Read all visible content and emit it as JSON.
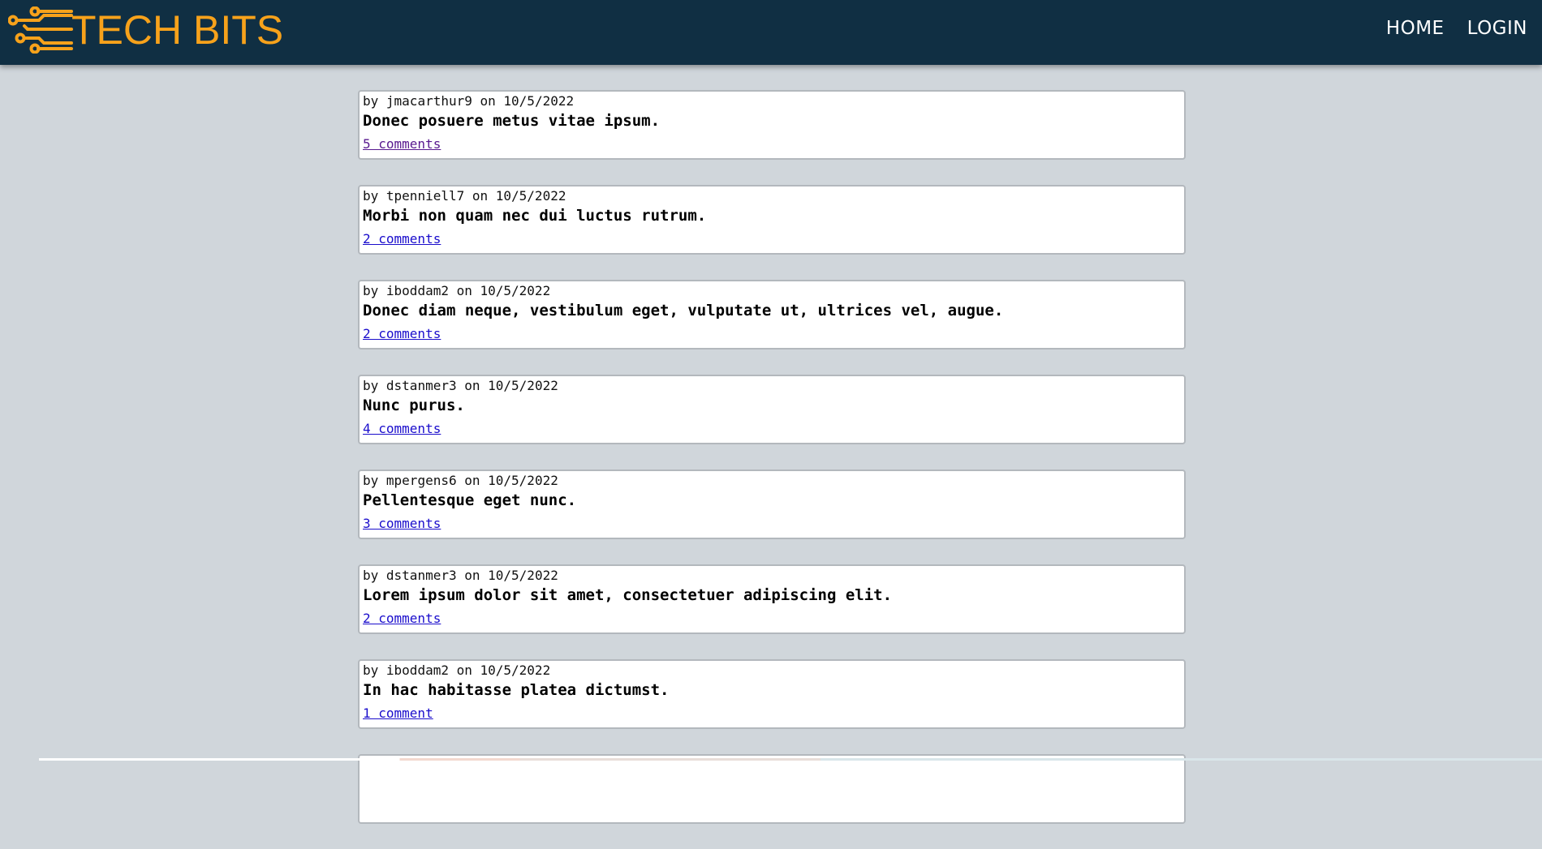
{
  "header": {
    "logo_text": "TECH BITS",
    "logo_icon": "circuit-icon",
    "nav": {
      "home": "HOME",
      "login": "LOGIN"
    },
    "colors": {
      "bar": "#102f43",
      "brand": "#f7a21b"
    }
  },
  "posts": [
    {
      "author": "jmacarthur9",
      "date": "10/5/2022",
      "title": "Donec posuere metus vitae ipsum.",
      "comments": "5 comments",
      "visited": true
    },
    {
      "author": "tpenniell7",
      "date": "10/5/2022",
      "title": "Morbi non quam nec dui luctus rutrum.",
      "comments": "2 comments",
      "visited": false
    },
    {
      "author": "iboddam2",
      "date": "10/5/2022",
      "title": "Donec diam neque, vestibulum eget, vulputate ut, ultrices vel, augue.",
      "comments": "2 comments",
      "visited": false
    },
    {
      "author": "dstanmer3",
      "date": "10/5/2022",
      "title": "Nunc purus.",
      "comments": "4 comments",
      "visited": false
    },
    {
      "author": "mpergens6",
      "date": "10/5/2022",
      "title": "Pellentesque eget nunc.",
      "comments": "3 comments",
      "visited": false
    },
    {
      "author": "dstanmer3",
      "date": "10/5/2022",
      "title": "Lorem ipsum dolor sit amet, consectetuer adipiscing elit.",
      "comments": "2 comments",
      "visited": false
    },
    {
      "author": "iboddam2",
      "date": "10/5/2022",
      "title": "In hac habitasse platea dictumst.",
      "comments": "1 comment",
      "visited": false
    }
  ]
}
